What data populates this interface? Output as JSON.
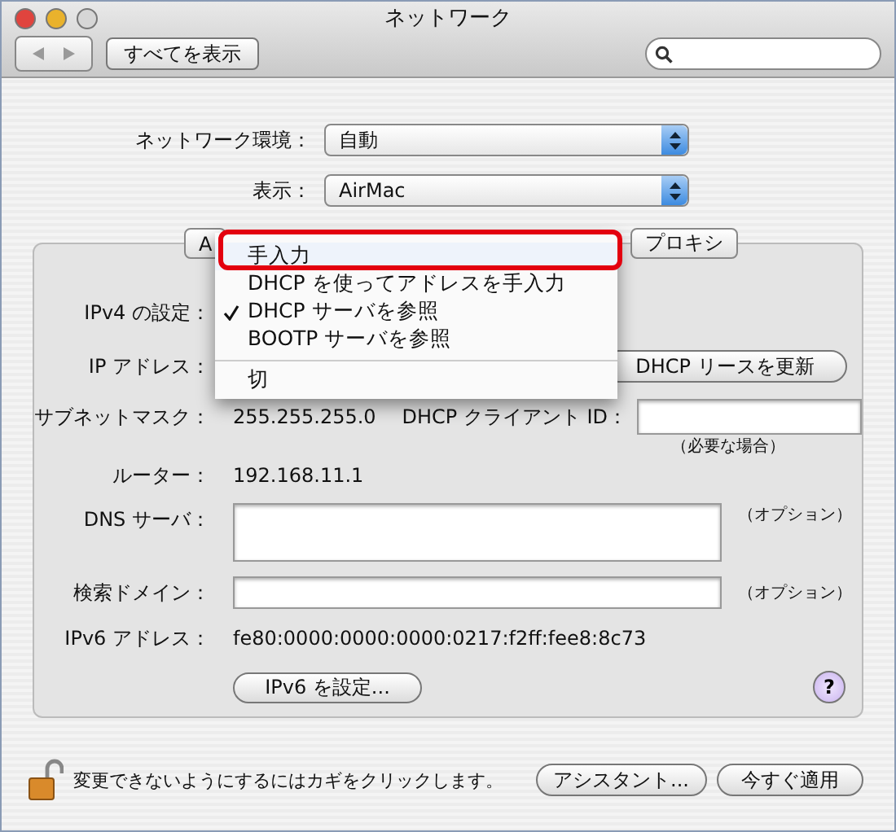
{
  "window": {
    "title": "ネットワーク"
  },
  "toolbar": {
    "show_all_button": "すべてを表示"
  },
  "location": {
    "label": "ネットワーク環境：",
    "value": "自動"
  },
  "show": {
    "label": "表示：",
    "value": "AirMac"
  },
  "tabs": [
    {
      "label": "A",
      "selected": false
    },
    {
      "label": "プロキシ",
      "selected": false
    }
  ],
  "ipv4_menu": {
    "items": [
      {
        "kind": "item",
        "label": "手入力",
        "checked": false,
        "highlighted": true
      },
      {
        "kind": "item",
        "label": "DHCP を使ってアドレスを手入力",
        "checked": false,
        "highlighted": false
      },
      {
        "kind": "item",
        "label": "DHCP サーバを参照",
        "checked": true,
        "highlighted": false
      },
      {
        "kind": "item",
        "label": "BOOTP サーバを参照",
        "checked": false,
        "highlighted": false
      },
      {
        "kind": "separator"
      },
      {
        "kind": "item",
        "label": "切",
        "checked": false,
        "highlighted": false
      }
    ]
  },
  "form": {
    "ipv4_label": "IPv4 の設定：",
    "ip_label": "IP アドレス：",
    "renew_button": "DHCP リースを更新",
    "subnet_label": "サブネットマスク：",
    "subnet_value": "255.255.255.0",
    "client_id_label": "DHCP クライアント ID：",
    "client_id_hint": "（必要な場合）",
    "router_label": "ルーター：",
    "router_value": "192.168.11.1",
    "dns_label": "DNS サーバ：",
    "dns_hint": "（オプション）",
    "domain_label": "検索ドメイン：",
    "domain_hint": "（オプション）",
    "ipv6_label": "IPv6 アドレス：",
    "ipv6_value": "fe80:0000:0000:0000:0217:f2ff:fee8:8c73",
    "ipv6_button": "IPv6 を設定...",
    "help": "?"
  },
  "footer": {
    "lock_text": "変更できないようにするにはカギをクリックします。",
    "assistant_button": "アシスタント...",
    "apply_button": "今すぐ適用"
  }
}
